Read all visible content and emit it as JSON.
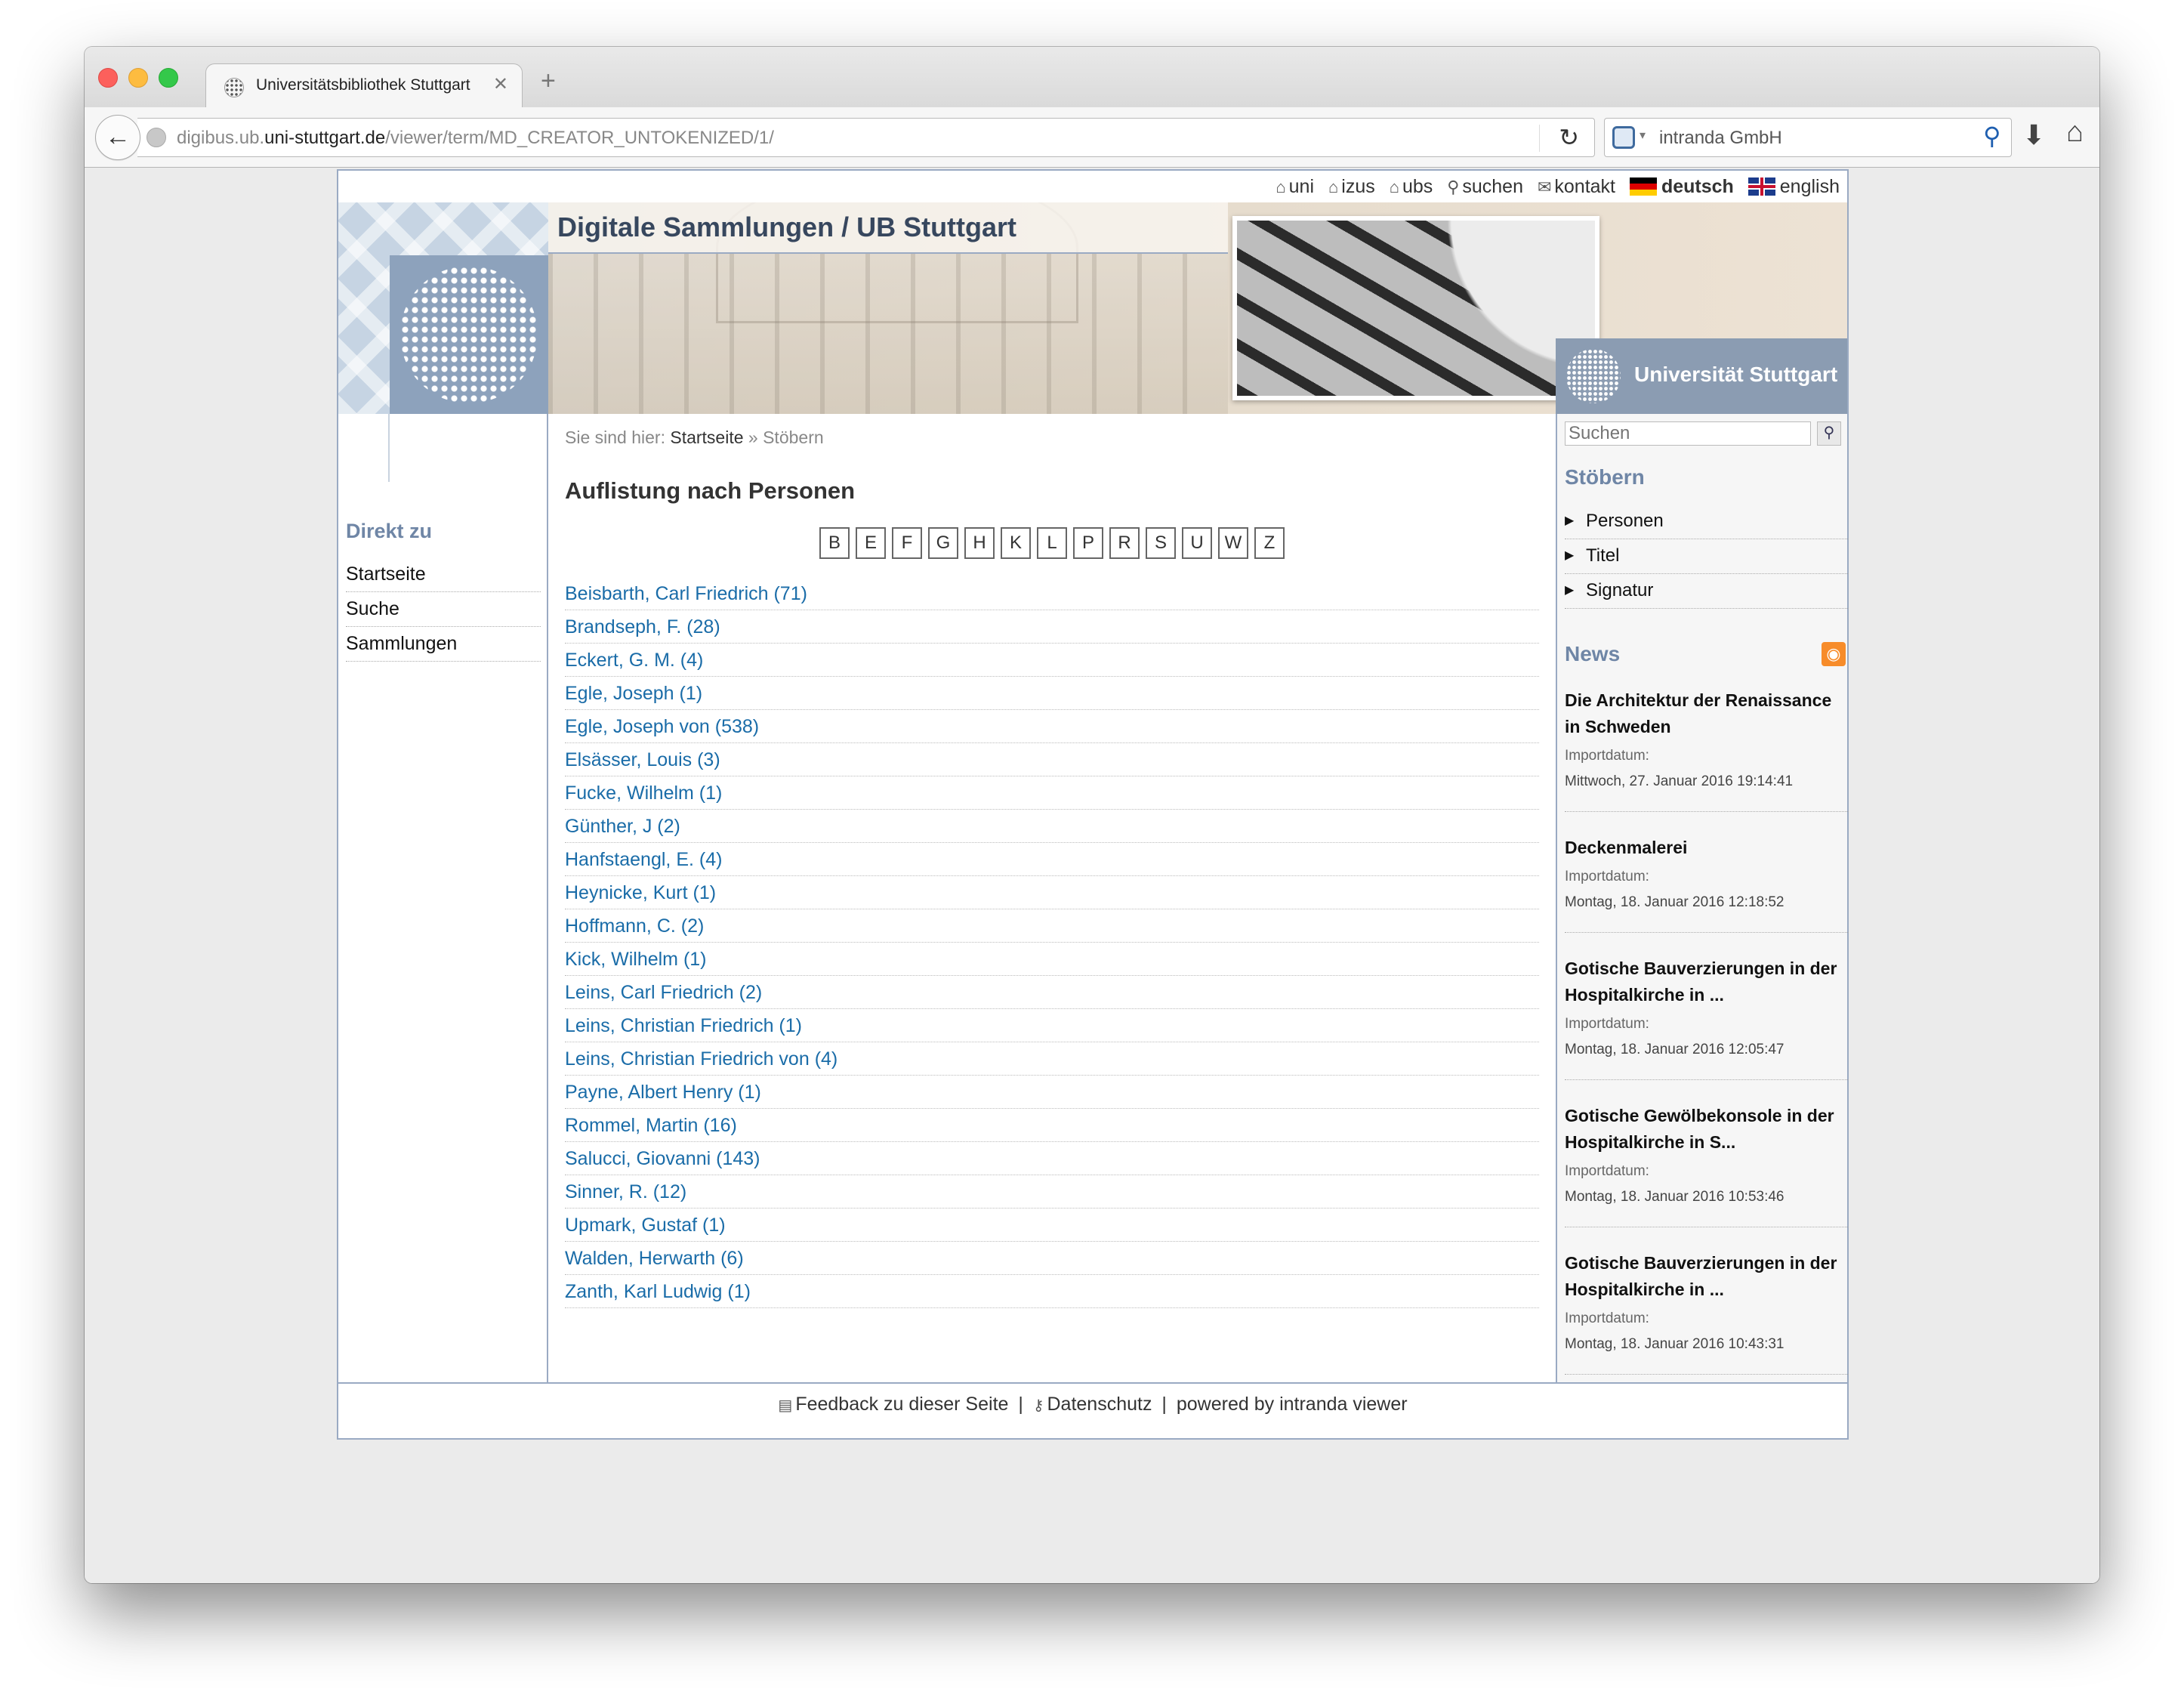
{
  "browser": {
    "tab_title": "Universitätsbibliothek Stuttgart",
    "new_tab": "+",
    "url_prefix": "digibus.ub.",
    "url_domain": "uni-stuttgart.de",
    "url_path": "/viewer/term/MD_CREATOR_UNTOKENIZED/1/",
    "search_engine_text": "intranda GmbH"
  },
  "topnav": {
    "uni": "uni",
    "izus": "izus",
    "ubs": "ubs",
    "suchen": "suchen",
    "kontakt": "kontakt",
    "deutsch": "deutsch",
    "english": "english"
  },
  "header": {
    "site_title": "Digitale Sammlungen / UB Stuttgart",
    "university": "Universität Stuttgart"
  },
  "breadcrumb": {
    "prefix": "Sie sind hier:",
    "home": "Startseite",
    "current": "» Stöbern"
  },
  "left_nav": {
    "heading": "Direkt zu",
    "items": [
      "Startseite",
      "Suche",
      "Sammlungen"
    ]
  },
  "content": {
    "heading": "Auflistung nach Personen",
    "letters": [
      "B",
      "E",
      "F",
      "G",
      "H",
      "K",
      "L",
      "P",
      "R",
      "S",
      "U",
      "W",
      "Z"
    ],
    "persons": [
      "Beisbarth, Carl Friedrich (71)",
      "Brandseph, F. (28)",
      "Eckert, G. M. (4)",
      "Egle, Joseph (1)",
      "Egle, Joseph von (538)",
      "Elsässer, Louis (3)",
      "Fucke, Wilhelm (1)",
      "Günther, J (2)",
      "Hanfstaengl, E. (4)",
      "Heynicke, Kurt (1)",
      "Hoffmann, C. (2)",
      "Kick, Wilhelm (1)",
      "Leins, Carl Friedrich (2)",
      "Leins, Christian Friedrich (1)",
      "Leins, Christian Friedrich von (4)",
      "Payne, Albert Henry (1)",
      "Rommel, Martin (16)",
      "Salucci, Giovanni (143)",
      "Sinner, R. (12)",
      "Upmark, Gustaf (1)",
      "Walden, Herwarth (6)",
      "Zanth, Karl Ludwig (1)"
    ]
  },
  "sidebar": {
    "search_placeholder": "Suchen",
    "browse_heading": "Stöbern",
    "browse_items": [
      "Personen",
      "Titel",
      "Signatur"
    ],
    "news_heading": "News",
    "news": [
      {
        "title": "Die Architektur der Renaissance in Schweden",
        "label": "Importdatum:",
        "date": "Mittwoch, 27. Januar 2016 19:14:41"
      },
      {
        "title": "Deckenmalerei",
        "label": "Importdatum:",
        "date": "Montag, 18. Januar 2016 12:18:52"
      },
      {
        "title": "Gotische Bauverzierungen in der Hospitalkirche in ...",
        "label": "Importdatum:",
        "date": "Montag, 18. Januar 2016 12:05:47"
      },
      {
        "title": "Gotische Gewölbekonsole in der Hospitalkirche in S...",
        "label": "Importdatum:",
        "date": "Montag, 18. Januar 2016 10:53:46"
      },
      {
        "title": "Gotische Bauverzierungen in der Hospitalkirche in ...",
        "label": "Importdatum:",
        "date": "Montag, 18. Januar 2016 10:43:31"
      }
    ]
  },
  "footer": {
    "feedback": "Feedback zu dieser Seite",
    "separator": "|",
    "privacy": "Datenschutz",
    "powered_prefix": "powered by",
    "powered_name": "intranda viewer"
  },
  "colors": {
    "link": "#1a6ca8",
    "accent": "#6f86a6",
    "frame": "#9aaac3",
    "rss": "#f78c2a"
  }
}
